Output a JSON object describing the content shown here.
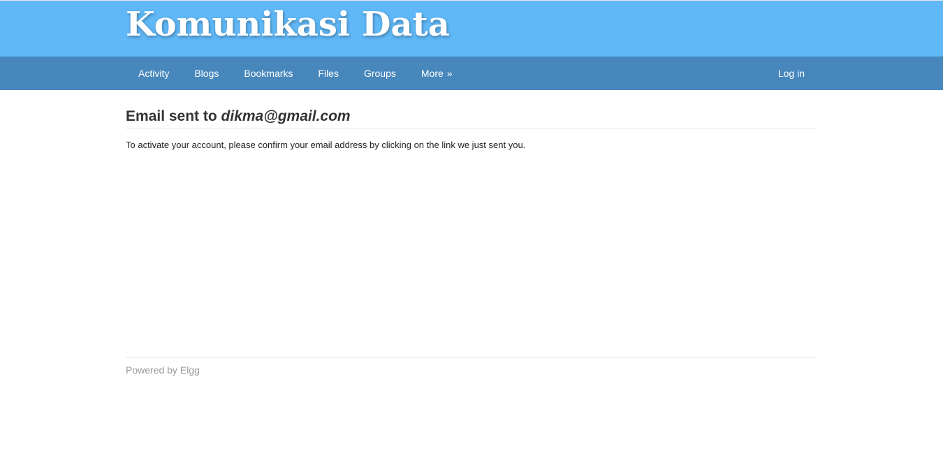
{
  "header": {
    "site_title": "Komunikasi Data"
  },
  "nav": {
    "items": [
      {
        "label": "Activity"
      },
      {
        "label": "Blogs"
      },
      {
        "label": "Bookmarks"
      },
      {
        "label": "Files"
      },
      {
        "label": "Groups"
      },
      {
        "label": "More",
        "suffix": "»"
      }
    ],
    "login_label": "Log in"
  },
  "main": {
    "title_prefix": "Email sent to",
    "title_email": "dikma@gmail.com",
    "message": "To activate your account, please confirm your email address by clicking on the link we just sent you."
  },
  "footer": {
    "powered_by": "Powered by Elgg"
  },
  "colors": {
    "header_bg": "#60b8f7",
    "nav_bg": "#4787bc"
  }
}
